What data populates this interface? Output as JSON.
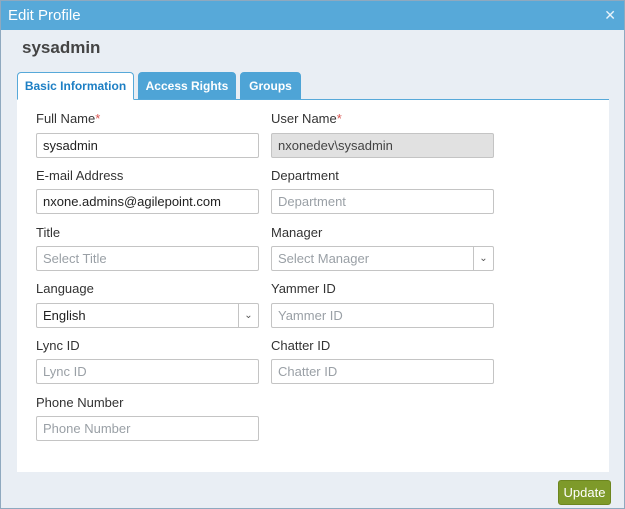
{
  "dialog": {
    "title": "Edit Profile",
    "close_icon": "close-icon"
  },
  "profile": {
    "username": "sysadmin"
  },
  "tabs": [
    {
      "label": "Basic Information",
      "active": true
    },
    {
      "label": "Access Rights",
      "active": false
    },
    {
      "label": "Groups",
      "active": false
    }
  ],
  "form": {
    "full_name": {
      "label": "Full Name",
      "required_marker": "*",
      "value": "sysadmin"
    },
    "user_name": {
      "label": "User Name",
      "required_marker": "*",
      "value": "nxonedev\\sysadmin",
      "disabled": true
    },
    "email": {
      "label": "E-mail Address",
      "value": "nxone.admins@agilepoint.com"
    },
    "department": {
      "label": "Department",
      "placeholder": "Department"
    },
    "title": {
      "label": "Title",
      "placeholder": "Select Title"
    },
    "manager": {
      "label": "Manager",
      "placeholder": "Select Manager"
    },
    "language": {
      "label": "Language",
      "value": "English"
    },
    "yammer_id": {
      "label": "Yammer ID",
      "placeholder": "Yammer ID"
    },
    "lync_id": {
      "label": "Lync ID",
      "placeholder": "Lync ID"
    },
    "chatter_id": {
      "label": "Chatter ID",
      "placeholder": "Chatter ID"
    },
    "phone_number": {
      "label": "Phone Number",
      "placeholder": "Phone Number"
    }
  },
  "footer": {
    "update_label": "Update"
  },
  "colors": {
    "title_bar": "#57a9d9",
    "tab_active_text": "#1d7fc4",
    "update_button": "#7e9a2a",
    "required": "#d9534f"
  }
}
